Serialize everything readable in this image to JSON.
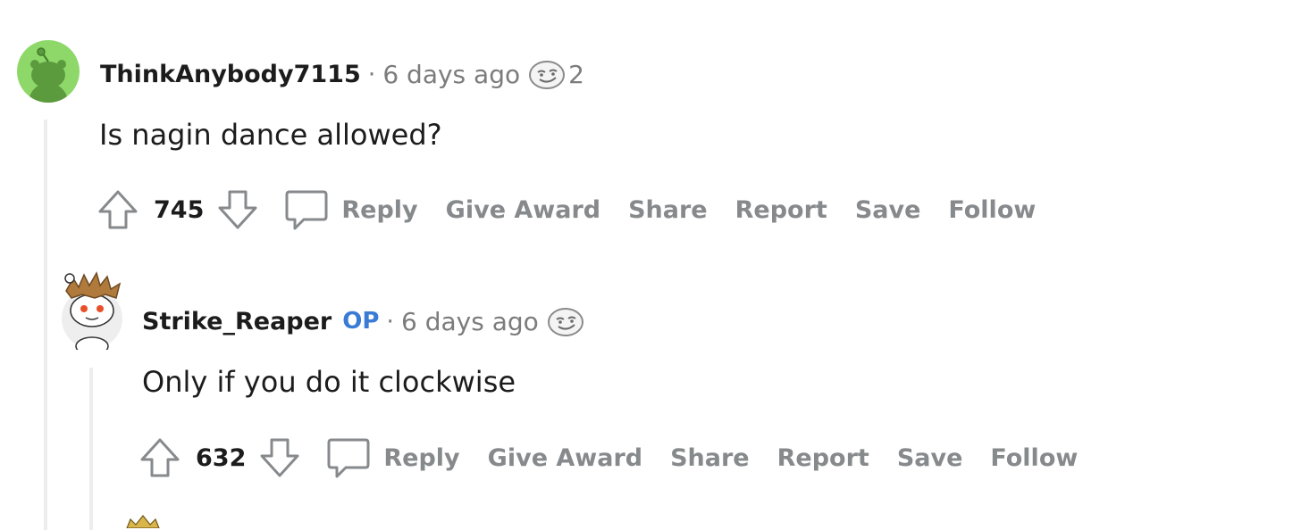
{
  "comments": [
    {
      "username": "ThinkAnybody7115",
      "separator": "·",
      "time": "6 days ago",
      "award_icon": "smug-face-award-icon",
      "award_count": "2",
      "text": "Is nagin dance allowed?",
      "score": "745",
      "actions": [
        "Reply",
        "Give Award",
        "Share",
        "Report",
        "Save",
        "Follow"
      ],
      "avatar_color": "#8ed86a"
    },
    {
      "username": "Strike_Reaper",
      "op_badge": "OP",
      "separator": "·",
      "time": "6 days ago",
      "award_icon": "smug-face-award-icon",
      "text": "Only if you do it clockwise",
      "score": "632",
      "actions": [
        "Reply",
        "Give Award",
        "Share",
        "Report",
        "Save",
        "Follow"
      ]
    }
  ],
  "colors": {
    "username": "#1c1c1c",
    "meta": "#7c7c7c",
    "action": "#878a8c",
    "op": "#3a7bd5",
    "thread_line": "#ededed"
  }
}
